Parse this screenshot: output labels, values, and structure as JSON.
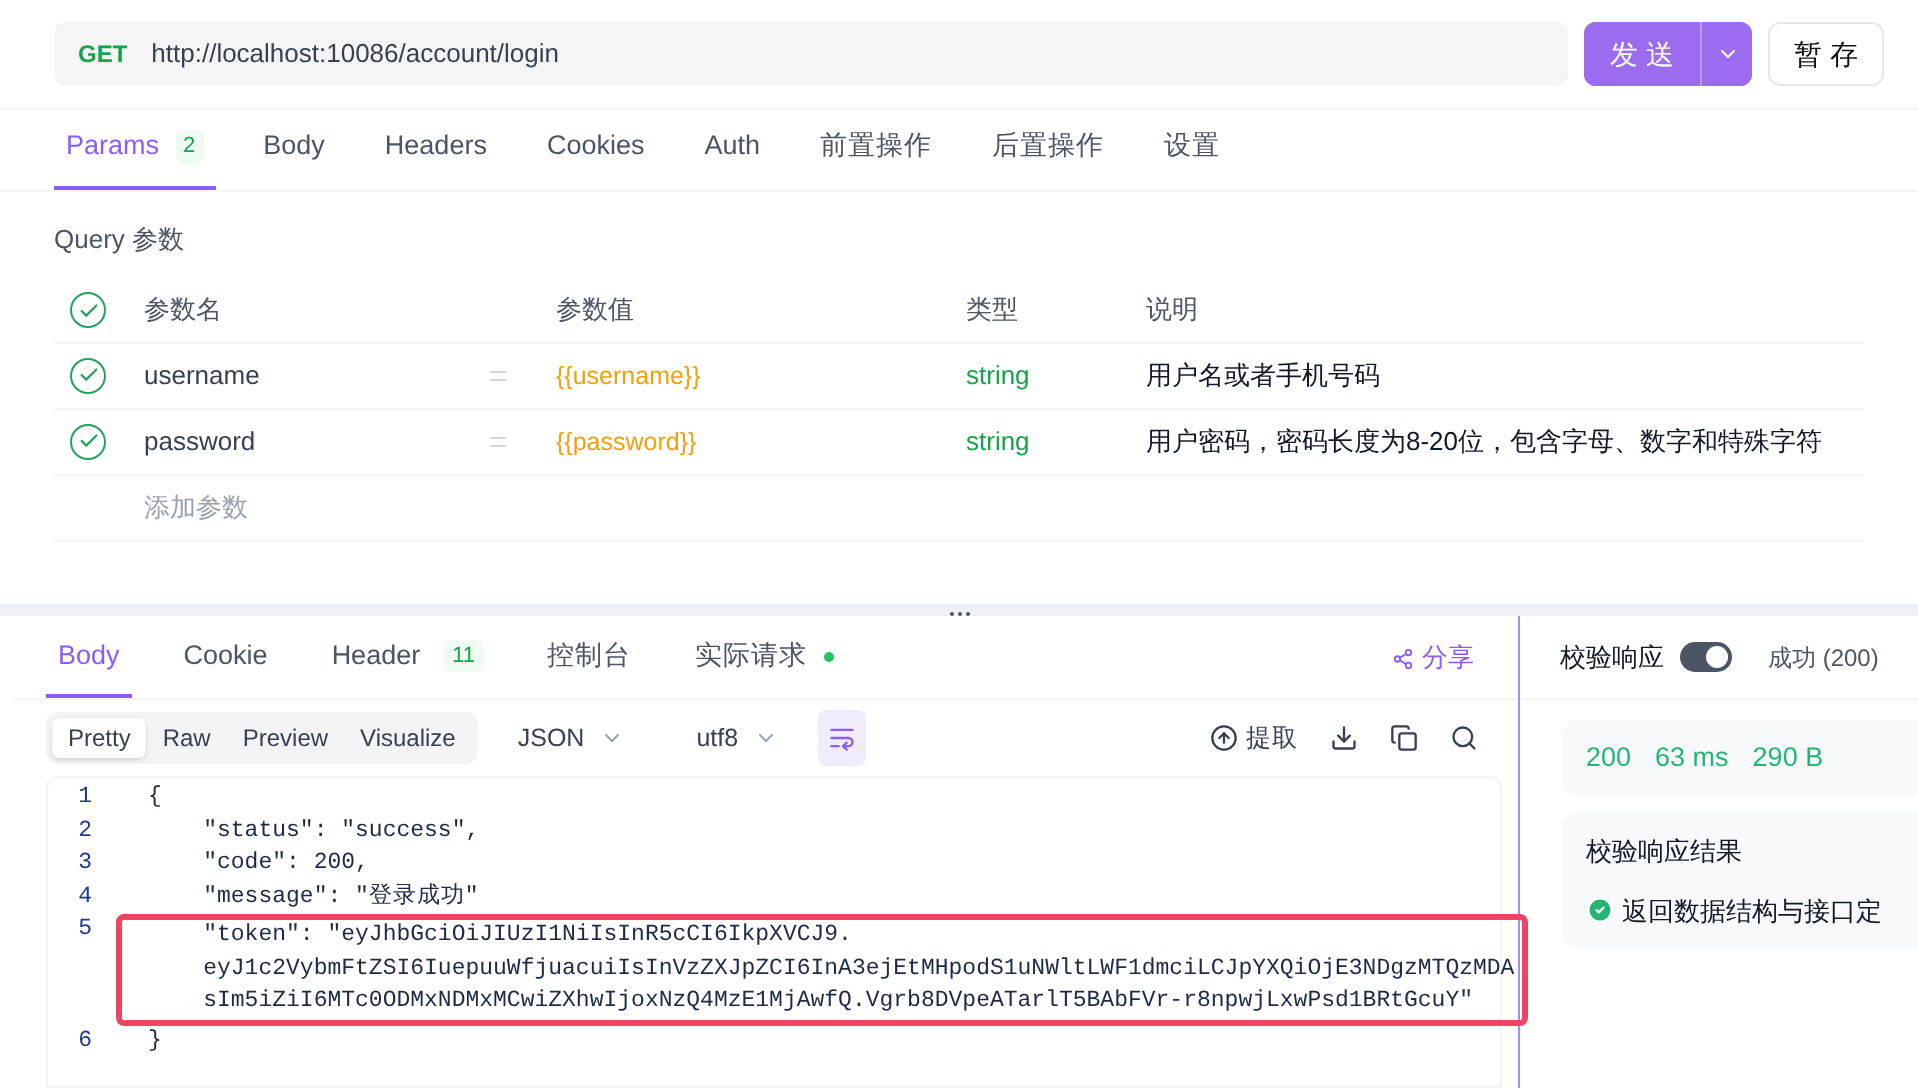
{
  "request": {
    "method": "GET",
    "url": "http://localhost:10086/account/login",
    "send_label": "发 送",
    "save_label": "暂 存"
  },
  "request_tabs": [
    {
      "label": "Params",
      "badge": "2",
      "selected": true
    },
    {
      "label": "Body",
      "selected": false
    },
    {
      "label": "Headers",
      "selected": false
    },
    {
      "label": "Cookies",
      "selected": false
    },
    {
      "label": "Auth",
      "selected": false
    },
    {
      "label": "前置操作",
      "selected": false
    },
    {
      "label": "后置操作",
      "selected": false
    },
    {
      "label": "设置",
      "selected": false
    }
  ],
  "query": {
    "title": "Query 参数",
    "header": {
      "checked": true,
      "columns": [
        "参数名",
        "参数值",
        "类型",
        "说明"
      ]
    },
    "rows": [
      {
        "checked": true,
        "name": "username",
        "value": "{{username}}",
        "type": "string",
        "description": "用户名或者手机号码"
      },
      {
        "checked": true,
        "name": "password",
        "value": "{{password}}",
        "type": "string",
        "description": "用户密码，密码长度为8-20位，包含字母、数字和特殊字符"
      }
    ],
    "add_placeholder": "添加参数"
  },
  "response_tabs": [
    {
      "label": "Body",
      "selected": true
    },
    {
      "label": "Cookie",
      "selected": false
    },
    {
      "label": "Header",
      "badge": "11",
      "selected": false
    },
    {
      "label": "控制台",
      "selected": false
    },
    {
      "label": "实际请求",
      "dot": true,
      "selected": false
    }
  ],
  "share_label": "分享",
  "view_modes": [
    {
      "label": "Pretty",
      "selected": true
    },
    {
      "label": "Raw",
      "selected": false
    },
    {
      "label": "Preview",
      "selected": false
    },
    {
      "label": "Visualize",
      "selected": false
    }
  ],
  "format": "JSON",
  "encoding": "utf8",
  "extract_label": "提取",
  "code_lines": [
    {
      "number": "1",
      "lines": [
        "{"
      ]
    },
    {
      "number": "2",
      "lines": [
        "    \"status\": \"success\","
      ]
    },
    {
      "number": "3",
      "lines": [
        "    \"code\": 200,"
      ]
    },
    {
      "number": "4",
      "lines": [
        "    \"message\": \"登录成功\""
      ]
    },
    {
      "number": "5",
      "highlighted": true,
      "lines": [
        "    \"token\": \"eyJhbGciOiJIUzI1NiIsInR5cCI6IkpXVCJ9.",
        "    eyJ1c2VybmFtZSI6IuepuuWfjuacuiIsInVzZXJpZCI6InA3ejEtMHpodS1uNWltLWF1dmciLCJpYXQiOjE3NDgzMTQzMDA",
        "    sIm5iZiI6MTc0ODMxNDMxMCwiZXhwIjoxNzQ4MzE1MjAwfQ.Vgrb8DVpeATarlT5BAbFVr-r8npwjLxwPsd1BRtGcuY\""
      ]
    },
    {
      "number": "6",
      "lines": [
        "}"
      ]
    }
  ],
  "validation": {
    "label": "校验响应",
    "on": true,
    "status": "成功 (200)",
    "status_code": "200",
    "time": "63 ms",
    "size": "290 B",
    "result_title": "校验响应结果",
    "result_text": "返回数据结构与接口定"
  }
}
